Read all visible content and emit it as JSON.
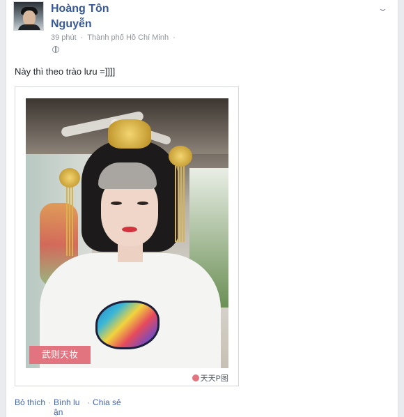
{
  "post": {
    "author": "Hoàng Tôn Nguyễn",
    "time": "39 phút",
    "location": "Thành phố Hồ Chí Minh",
    "privacy_icon": "globe-icon",
    "text": "Này thì theo trào lưu =]]]]"
  },
  "photo": {
    "overlay_tag": "武则天妆",
    "watermark": "天天P图"
  },
  "actions": {
    "like": "Bỏ thích",
    "comment": "Bình luận",
    "share": "Chia sẻ"
  },
  "menu": {
    "chevron_icon": "chevron-down-icon"
  },
  "colors": {
    "link": "#365899",
    "action": "#4267b2",
    "meta": "#90949c",
    "tag": "#e2747f"
  }
}
